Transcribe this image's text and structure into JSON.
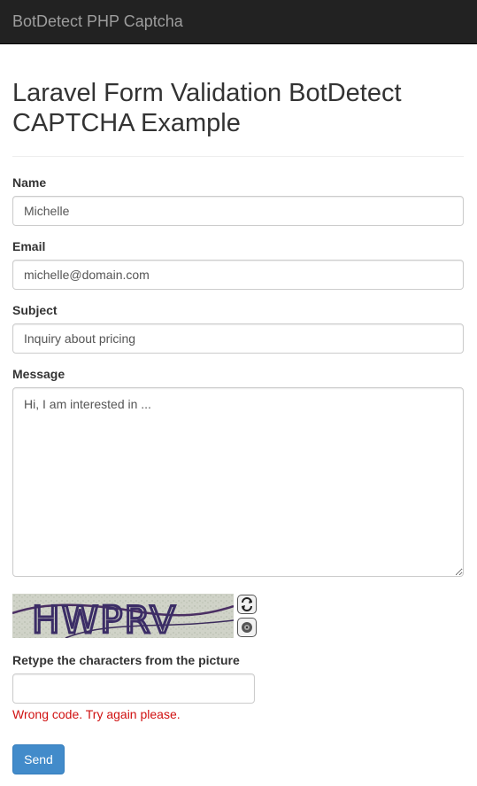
{
  "navbar": {
    "brand": "BotDetect PHP Captcha"
  },
  "page": {
    "title": "Laravel Form Validation BotDetect CAPTCHA Example"
  },
  "form": {
    "name": {
      "label": "Name",
      "value": "Michelle"
    },
    "email": {
      "label": "Email",
      "value": "michelle@domain.com"
    },
    "subject": {
      "label": "Subject",
      "value": "Inquiry about pricing"
    },
    "message": {
      "label": "Message",
      "value": "Hi, I am interested in ..."
    },
    "captcha": {
      "image_text": "HWPRV",
      "reload_icon": "refresh-icon",
      "sound_icon": "speaker-icon",
      "label": "Retype the characters from the picture",
      "value": "",
      "error": "Wrong code. Try again please."
    },
    "send_label": "Send"
  },
  "colors": {
    "navbar_bg": "#222222",
    "brand_text": "#9d9d9d",
    "primary": "#428bca",
    "error": "#d01010"
  }
}
